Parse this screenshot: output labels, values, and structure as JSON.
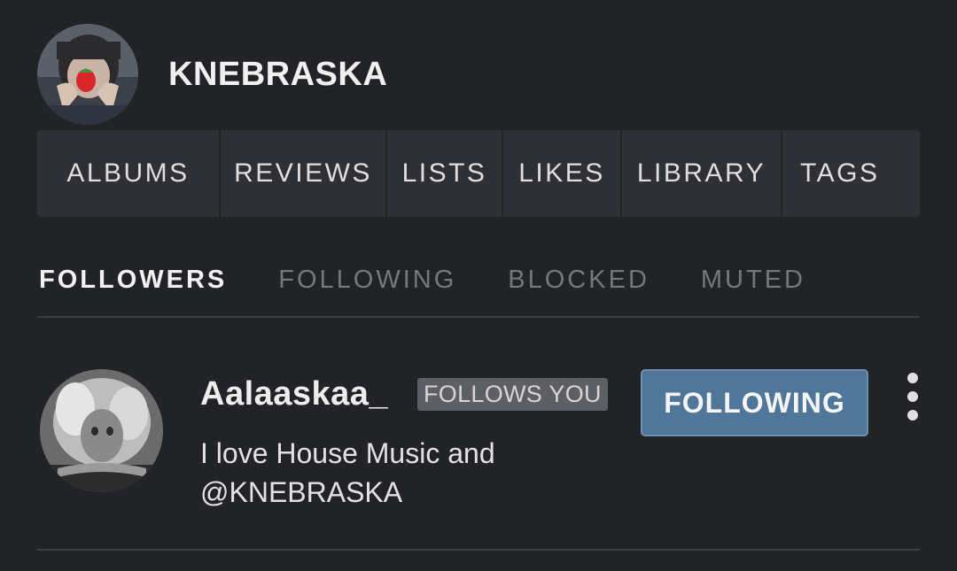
{
  "profile": {
    "username": "KNEBRASKA"
  },
  "main_nav": [
    {
      "label": "ALBUMS"
    },
    {
      "label": "REVIEWS"
    },
    {
      "label": "LISTS"
    },
    {
      "label": "LIKES"
    },
    {
      "label": "LIBRARY"
    },
    {
      "label": "TAGS"
    }
  ],
  "sub_tabs": {
    "active": "FOLLOWERS",
    "items": [
      {
        "label": "FOLLOWERS"
      },
      {
        "label": "FOLLOWING"
      },
      {
        "label": "BLOCKED"
      },
      {
        "label": "MUTED"
      }
    ]
  },
  "followers": [
    {
      "name": "Aalaaskaa_",
      "badge": "FOLLOWS YOU",
      "bio_line1": "I love House Music and",
      "bio_line2": "@KNEBRASKA",
      "button_label": "FOLLOWING",
      "button_color": "#507699"
    }
  ],
  "icons": {
    "more": "more-vertical-icon"
  },
  "colors": {
    "background": "#222327",
    "nav_background": "#2e3035",
    "accent": "#507699",
    "inactive_tab": "#74777d"
  }
}
